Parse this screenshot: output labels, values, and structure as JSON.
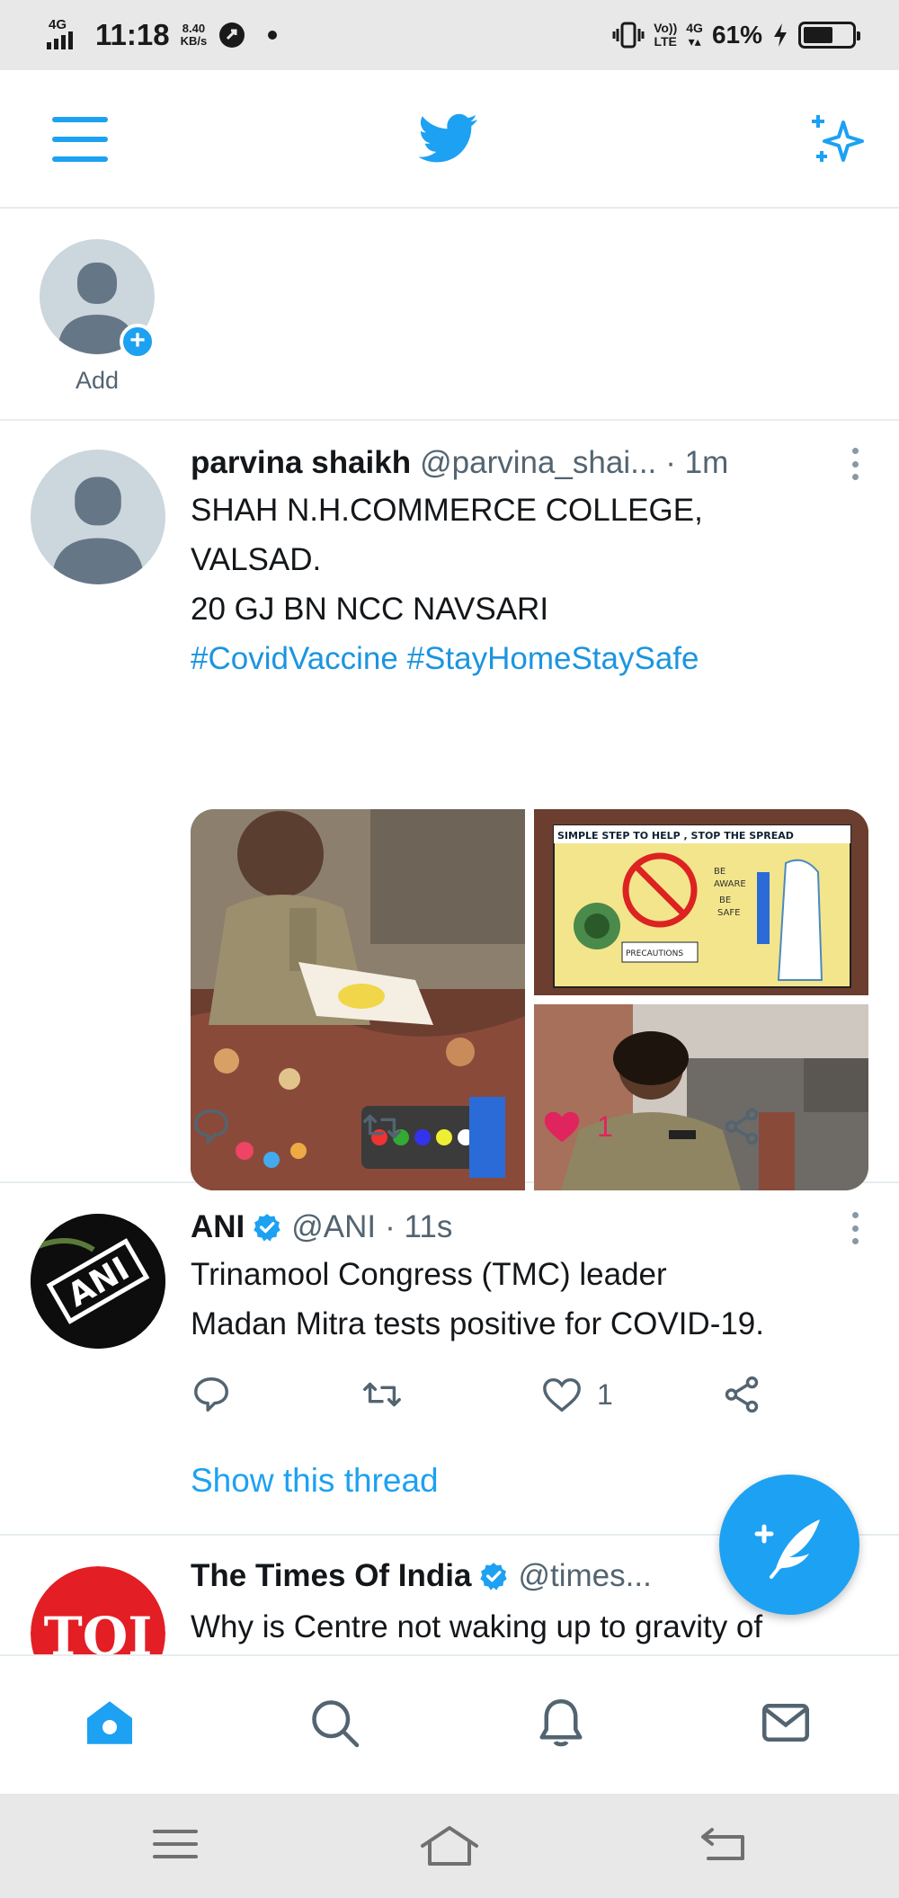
{
  "status_bar": {
    "network": "4G",
    "time": "11:18",
    "speed_value": "8.40",
    "speed_unit": "KB/s",
    "volte_top": "Vo))",
    "volte_bottom": "LTE",
    "net2": "4G",
    "battery_percent": "61%",
    "battery_level": 0.61
  },
  "fleets": {
    "add_label": "Add"
  },
  "tweets": [
    {
      "name": "parvina shaikh",
      "handle": "@parvina_shai...",
      "time": "· 1m",
      "text_lines": [
        "SHAH N.H.COMMERCE COLLEGE,",
        "VALSAD.",
        "20 GJ BN NCC NAVSARI"
      ],
      "hashtags": "#CovidVaccine #StayHomeStaySafe",
      "like_count": "1",
      "liked": true
    },
    {
      "name": "ANI",
      "handle": "@ANI",
      "time": "· 11s",
      "verified": true,
      "text_lines": [
        "Trinamool Congress (TMC) leader",
        "Madan Mitra tests positive for COVID-19."
      ],
      "like_count": "1",
      "liked": false,
      "show_thread": "Show this thread",
      "avatar_text": "ANI"
    },
    {
      "name": "The Times Of India",
      "handle": "@times...",
      "verified": true,
      "text_lines": [
        "Why is Centre not waking up to gravity of"
      ],
      "avatar_text": "TOI"
    }
  ],
  "poster_text": {
    "header": "SIMPLE STEP TO HELP , STOP THE SPREAD",
    "be": "BE",
    "aware": "AWARE",
    "be2": "BE",
    "safe": "SAFE",
    "precautions": "PRECAUTIONS"
  },
  "colors": {
    "accent": "#1da1f2",
    "like": "#e0245e",
    "secondary_text": "#536471"
  },
  "icons": {
    "menu": "menu-icon",
    "logo": "twitter-bird-icon",
    "sparkle": "sparkle-icon",
    "compose": "compose-tweet-icon",
    "home": "home-icon",
    "search": "search-icon",
    "notifications": "bell-icon",
    "messages": "mail-icon"
  }
}
